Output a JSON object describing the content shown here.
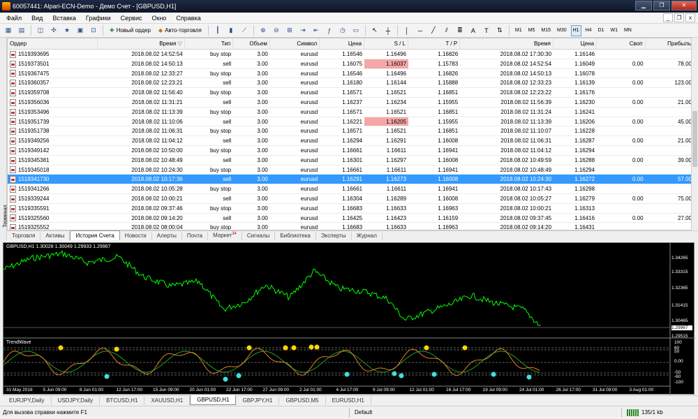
{
  "window": {
    "title": "60057441: Alpari-ECN-Demo - Демо Счет - [GBPUSD,H1]"
  },
  "menu": [
    "Файл",
    "Вид",
    "Вставка",
    "Графики",
    "Сервис",
    "Окно",
    "Справка"
  ],
  "toolbar": {
    "new_order_label": "Новый ордер",
    "autotrading_label": "Авто-торговля",
    "timeframes": [
      "M1",
      "M5",
      "M15",
      "M30",
      "H1",
      "H4",
      "D1",
      "W1",
      "MN"
    ],
    "active_timeframe": "H1"
  },
  "terminal": {
    "side_label": "Терминал",
    "columns": [
      "Ордер",
      "Время",
      "Тип",
      "Объем",
      "Символ",
      "Цена",
      "S / L",
      "T / P",
      "Время",
      "Цена",
      "Своп",
      "Прибыль"
    ],
    "rows": [
      {
        "order": "1519393695",
        "time": "2018.08.02 14:52:54",
        "type": "buy stop",
        "volume": "3.00",
        "symbol": "eurusd",
        "price": "1.16546",
        "sl": "1.16496",
        "tp": "1.16826",
        "close_time": "2018.08.02 17:30:30",
        "close_price": "1.16146",
        "swap": "",
        "profit": ""
      },
      {
        "order": "1519373501",
        "time": "2018.08.02 14:50:13",
        "type": "sell",
        "volume": "3.00",
        "symbol": "eurusd",
        "price": "1.16075",
        "sl": "1.16037",
        "tp": "1.15783",
        "close_time": "2018.08.02 14:52:54",
        "close_price": "1.16049",
        "swap": "0.00",
        "profit": "78.00",
        "sl_hit": true
      },
      {
        "order": "1519367475",
        "time": "2018.08.02 12:33:27",
        "type": "buy stop",
        "volume": "3.00",
        "symbol": "eurusd",
        "price": "1.16546",
        "sl": "1.16496",
        "tp": "1.16826",
        "close_time": "2018.08.02 14:50:13",
        "close_price": "1.16078",
        "swap": "",
        "profit": ""
      },
      {
        "order": "1519360357",
        "time": "2018.08.02 12:23:21",
        "type": "sell",
        "volume": "3.00",
        "symbol": "eurusd",
        "price": "1.16180",
        "sl": "1.16144",
        "tp": "1.15888",
        "close_time": "2018.08.02 12:33:23",
        "close_price": "1.16139",
        "swap": "0.00",
        "profit": "123.00"
      },
      {
        "order": "1519359708",
        "time": "2018.08.02 11:56:40",
        "type": "buy stop",
        "volume": "3.00",
        "symbol": "eurusd",
        "price": "1.16571",
        "sl": "1.16521",
        "tp": "1.16851",
        "close_time": "2018.08.02 12:23:22",
        "close_price": "1.16176",
        "swap": "",
        "profit": ""
      },
      {
        "order": "1519356036",
        "time": "2018.08.02 11:31:21",
        "type": "sell",
        "volume": "3.00",
        "symbol": "eurusd",
        "price": "1.16237",
        "sl": "1.16234",
        "tp": "1.15955",
        "close_time": "2018.08.02 11:56:39",
        "close_price": "1.16230",
        "swap": "0.00",
        "profit": "21.00"
      },
      {
        "order": "1519353496",
        "time": "2018.08.02 11:13:39",
        "type": "buy stop",
        "volume": "3.00",
        "symbol": "eurusd",
        "price": "1.16571",
        "sl": "1.16521",
        "tp": "1.16851",
        "close_time": "2018.08.02 11:31:24",
        "close_price": "1.16241",
        "swap": "",
        "profit": ""
      },
      {
        "order": "1519351739",
        "time": "2018.08.02 11:10:06",
        "type": "sell",
        "volume": "3.00",
        "symbol": "eurusd",
        "price": "1.16221",
        "sl": "1.16205",
        "tp": "1.15955",
        "close_time": "2018.08.02 11:13:39",
        "close_price": "1.16206",
        "swap": "0.00",
        "profit": "45.00",
        "sl_hit": true
      },
      {
        "order": "1519351738",
        "time": "2018.08.02 11:06:31",
        "type": "buy stop",
        "volume": "3.00",
        "symbol": "eurusd",
        "price": "1.16571",
        "sl": "1.16521",
        "tp": "1.16851",
        "close_time": "2018.08.02 11:10:07",
        "close_price": "1.16228",
        "swap": "",
        "profit": ""
      },
      {
        "order": "1519349256",
        "time": "2018.08.02 11:04:12",
        "type": "sell",
        "volume": "3.00",
        "symbol": "eurusd",
        "price": "1.16294",
        "sl": "1.16291",
        "tp": "1.16008",
        "close_time": "2018.08.02 11:06:31",
        "close_price": "1.16287",
        "swap": "0.00",
        "profit": "21.00"
      },
      {
        "order": "1519349142",
        "time": "2018.08.02 10:50:00",
        "type": "buy stop",
        "volume": "3.00",
        "symbol": "eurusd",
        "price": "1.16661",
        "sl": "1.16611",
        "tp": "1.16941",
        "close_time": "2018.08.02 11:04:12",
        "close_price": "1.16294",
        "swap": "",
        "profit": ""
      },
      {
        "order": "1519345381",
        "time": "2018.08.02 10:48:49",
        "type": "sell",
        "volume": "3.00",
        "symbol": "eurusd",
        "price": "1.16301",
        "sl": "1.16297",
        "tp": "1.16008",
        "close_time": "2018.08.02 10:49:59",
        "close_price": "1.16288",
        "swap": "0.00",
        "profit": "39.00"
      },
      {
        "order": "1519345018",
        "time": "2018.08.02 10:24:30",
        "type": "buy stop",
        "volume": "3.00",
        "symbol": "eurusd",
        "price": "1.16661",
        "sl": "1.16611",
        "tp": "1.16941",
        "close_time": "2018.08.02 10:48:49",
        "close_price": "1.16294",
        "swap": "",
        "profit": ""
      },
      {
        "order": "1519341730",
        "time": "2018.08.02 10:17:36",
        "type": "sell",
        "volume": "3.00",
        "symbol": "eurusd",
        "price": "1.16291",
        "sl": "1.16273",
        "tp": "1.16008",
        "close_time": "2018.08.02 10:24:30",
        "close_price": "1.16272",
        "swap": "0.00",
        "profit": "57.00",
        "selected": true
      },
      {
        "order": "1519341266",
        "time": "2018.08.02 10:05:28",
        "type": "buy stop",
        "volume": "3.00",
        "symbol": "eurusd",
        "price": "1.16661",
        "sl": "1.16611",
        "tp": "1.16941",
        "close_time": "2018.08.02 10:17:43",
        "close_price": "1.16298",
        "swap": "",
        "profit": ""
      },
      {
        "order": "1519339244",
        "time": "2018.08.02 10:00:21",
        "type": "sell",
        "volume": "3.00",
        "symbol": "eurusd",
        "price": "1.16304",
        "sl": "1.16289",
        "tp": "1.16008",
        "close_time": "2018.08.02 10:05:27",
        "close_price": "1.16279",
        "swap": "0.00",
        "profit": "75.00"
      },
      {
        "order": "1519335591",
        "time": "2018.08.02 09:37:46",
        "type": "buy stop",
        "volume": "3.00",
        "symbol": "eurusd",
        "price": "1.16683",
        "sl": "1.16633",
        "tp": "1.16963",
        "close_time": "2018.08.02 10:00:21",
        "close_price": "1.16313",
        "swap": "",
        "profit": ""
      },
      {
        "order": "1519325560",
        "time": "2018.08.02 09:14:20",
        "type": "sell",
        "volume": "3.00",
        "symbol": "eurusd",
        "price": "1.16425",
        "sl": "1.16423",
        "tp": "1.16159",
        "close_time": "2018.08.02 09:37:45",
        "close_price": "1.16416",
        "swap": "0.00",
        "profit": "27.00"
      },
      {
        "order": "1519325552",
        "time": "2018.08.02 08:00:04",
        "type": "buy stop",
        "volume": "3.00",
        "symbol": "eurusd",
        "price": "1.16683",
        "sl": "1.16633",
        "tp": "1.16963",
        "close_time": "2018.08.02 09:14:20",
        "close_price": "1.16431",
        "swap": "",
        "profit": ""
      }
    ],
    "tabs": [
      {
        "label": "Торговля"
      },
      {
        "label": "Активы"
      },
      {
        "label": "История Счета",
        "active": true
      },
      {
        "label": "Новости"
      },
      {
        "label": "Алерты"
      },
      {
        "label": "Почта"
      },
      {
        "label": "Маркет",
        "badge": "34"
      },
      {
        "label": "Сигналы"
      },
      {
        "label": "Библиотека"
      },
      {
        "label": "Эксперты"
      },
      {
        "label": "Журнал"
      }
    ]
  },
  "chart": {
    "header": "GBPUSD,H1  1.30028 1.30049 1.29933 1.29967",
    "indicator_name": "TrendWave",
    "price_scale": [
      "1.34265",
      "1.33315",
      "1.32365",
      "1.31415",
      "1.30465",
      "1.29967",
      "1.29515"
    ],
    "current_price": "1.29967",
    "indicator_scale": [
      "100",
      "60",
      "50",
      "0.00",
      "-50",
      "-60",
      "-100"
    ],
    "dates": [
      "31 May 2018",
      "5 Jun 09:00",
      "8 Jun 01:00",
      "12 Jun 17:00",
      "15 Jun 09:00",
      "20 Jun 01:00",
      "22 Jun 17:00",
      "27 Jun 09:00",
      "2 Jul 01:00",
      "4 Jul 17:00",
      "9 Jul 09:00",
      "12 Jul 01:00",
      "16 Jul 17:00",
      "19 Jul 09:00",
      "24 Jul 01:00",
      "26 Jul 17:00",
      "31 Jul 09:00",
      "3 Aug 01:00"
    ],
    "line_color": "#00ff00",
    "background": "#000000"
  },
  "chart_tabs": [
    {
      "label": "EURJPY,Daily"
    },
    {
      "label": "USDJPY,Daily"
    },
    {
      "label": "BTCUSD,H1"
    },
    {
      "label": "XAUUSD,H1"
    },
    {
      "label": "GBPUSD,H1",
      "active": true
    },
    {
      "label": "GBPJPY,H1"
    },
    {
      "label": "GBPUSD,M5"
    },
    {
      "label": "EURUSD,H1"
    }
  ],
  "status": {
    "help_hint": "Для вызова справки нажмите F1",
    "profile": "Default",
    "traffic": "135/1 kb"
  }
}
